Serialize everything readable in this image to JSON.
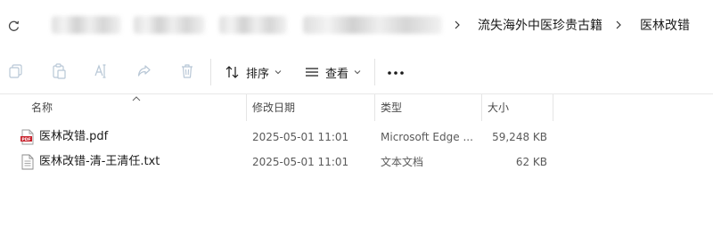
{
  "breadcrumbs": [
    "流失海外中医珍贵古籍",
    "医林改错"
  ],
  "toolbar": {
    "sort_label": "排序",
    "view_label": "查看"
  },
  "columns": {
    "name": "名称",
    "date": "修改日期",
    "type": "类型",
    "size": "大小"
  },
  "files": [
    {
      "name": "医林改错.pdf",
      "date": "2025-05-01 11:01",
      "type": "Microsoft Edge ...",
      "size": "59,248 KB",
      "icon": "pdf-file-icon",
      "badge": "PDF"
    },
    {
      "name": "医林改错-清-王清任.txt",
      "date": "2025-05-01 11:01",
      "type": "文本文档",
      "size": "62 KB",
      "icon": "text-file-icon"
    }
  ],
  "colors": {
    "pdf_red": "#c8202a"
  }
}
